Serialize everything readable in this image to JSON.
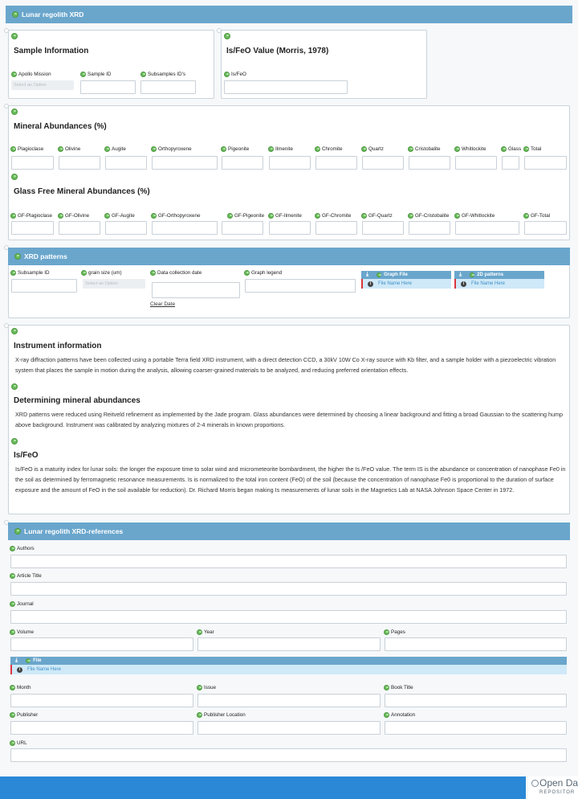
{
  "header": {
    "title": "Lunar regolith XRD"
  },
  "sample_info": {
    "title": "Sample Information",
    "apollo_label": "Apollo Mission",
    "apollo_placeholder": "Select an Option",
    "sample_id_label": "Sample ID",
    "subsample_label": "Subsamples ID's"
  },
  "isfeo_value": {
    "title": "Is/FeO Value (Morris, 1978)",
    "field_label": "Is/FeO"
  },
  "minerals": {
    "title": "Mineral Abundances (%)",
    "fields": [
      "Plagioclase",
      "Olivine",
      "Augite",
      "Orthopyroxene",
      "Pigeonite",
      "Ilmenite",
      "Chromite",
      "Quartz",
      "Cristobalite",
      "Whitlockite",
      "Glass",
      "Total"
    ]
  },
  "glass_free": {
    "title": "Glass Free Mineral Abundances (%)",
    "fields": [
      "GF-Plagioclase",
      "GF-Olivine",
      "GF-Augite",
      "GF-Orthopyroxene",
      "GF-Pigeonite",
      "GF-Ilmenite",
      "GF-Chromite",
      "GF-Quartz",
      "GF-Cristobalite",
      "GF-Whitlockite",
      "GF-Total"
    ]
  },
  "xrd": {
    "title": "XRD patterns",
    "subsample_label": "Subsample ID",
    "grain_label": "grain size (um)",
    "grain_placeholder": "Select an Option",
    "date_label": "Data collection date",
    "clear_date": "Clear Date",
    "legend_label": "Graph legend",
    "graph_file_label": "Graph File",
    "patterns_label": "2D patterns",
    "file_placeholder": "File Name Here"
  },
  "info": {
    "instrument_title": "Instrument information",
    "instrument_text": "X-ray diffraction patterns have been collected using a portable Terra field XRD instrument, with a direct detection CCD, a 30kV 10W Co X-ray source with Kb filter, and a sample holder with a piezoelectric vibration system that places the sample in motion during the analysis, allowing coarser-grained materials to be analyzed, and reducing preferred orientation effects.",
    "mineral_title": "Determining mineral abundances",
    "mineral_text": "XRD patterns were reduced using Reitveld refinement as implemented by the Jade program. Glass abundances were determined by choosing a linear background and fitting a broad Gaussian to the scattering hump above background. Instrument was calibrated by analyzing mixtures of 2-4 minerals in known proportions.",
    "isfeo_title": "Is/FeO",
    "isfeo_text": "Is/FeO is a maturity index for lunar soils: the longer the exposure time to solar wind and micrometeorite bombardment, the higher the Is /FeO value. The term IS is the abundance or concentration of nanophase Fe0 in the soil as determined by ferromagnetic resonance measurements. Is is normalized to the total iron content (FeO) of the soil (because the concentration of nanophase Fe0 is proportional to the duration of surface exposure and the amount of FeO in the soil available for reduction). Dr. Richard Morris began making Is measurements of lunar soils in the Magnetics Lab at NASA Johnson Space Center in 1972."
  },
  "refs": {
    "title": "Lunar regolith XRD-references",
    "authors": "Authors",
    "article_title": "Article Title",
    "journal": "Journal",
    "volume": "Volume",
    "year": "Year",
    "pages": "Pages",
    "file": "File",
    "file_placeholder": "File Name Here",
    "month": "Month",
    "issue": "Issue",
    "book_title": "Book Title",
    "publisher": "Publisher",
    "publisher_location": "Publisher Location",
    "annotation": "Annotation",
    "url": "URL"
  },
  "footer": {
    "logo_line1": "Open Dat",
    "logo_line2": "REPOSITOR"
  },
  "colors": {
    "header": "#6aa6cc",
    "footer": "#2a88d6",
    "accent_green": "#69bb5b",
    "file_bg": "#cfe9f8",
    "file_marker": "#d9363e"
  }
}
